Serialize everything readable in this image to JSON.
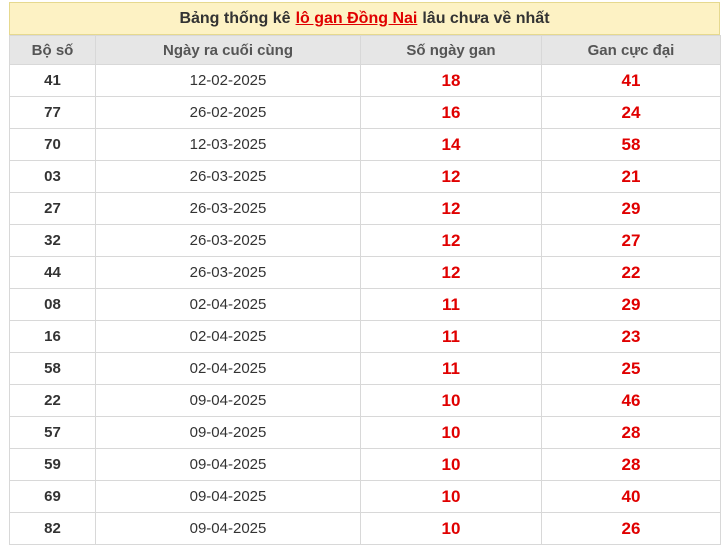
{
  "title": {
    "prefix": "Bảng thống kê",
    "link": "lô gan Đồng Nai",
    "suffix": "lâu chưa về nhất"
  },
  "columns": [
    "Bộ số",
    "Ngày ra cuối cùng",
    "Số ngày gan",
    "Gan cực đại"
  ],
  "rows": [
    [
      "41",
      "12-02-2025",
      "18",
      "41"
    ],
    [
      "77",
      "26-02-2025",
      "16",
      "24"
    ],
    [
      "70",
      "12-03-2025",
      "14",
      "58"
    ],
    [
      "03",
      "26-03-2025",
      "12",
      "21"
    ],
    [
      "27",
      "26-03-2025",
      "12",
      "29"
    ],
    [
      "32",
      "26-03-2025",
      "12",
      "27"
    ],
    [
      "44",
      "26-03-2025",
      "12",
      "22"
    ],
    [
      "08",
      "02-04-2025",
      "11",
      "29"
    ],
    [
      "16",
      "02-04-2025",
      "11",
      "23"
    ],
    [
      "58",
      "02-04-2025",
      "11",
      "25"
    ],
    [
      "22",
      "09-04-2025",
      "10",
      "46"
    ],
    [
      "57",
      "09-04-2025",
      "10",
      "28"
    ],
    [
      "59",
      "09-04-2025",
      "10",
      "28"
    ],
    [
      "69",
      "09-04-2025",
      "10",
      "40"
    ],
    [
      "82",
      "09-04-2025",
      "10",
      "26"
    ]
  ],
  "colors": {
    "accent_red": "#e00000",
    "title_bg": "#fdf2c4",
    "header_bg": "#e6e6e6"
  }
}
